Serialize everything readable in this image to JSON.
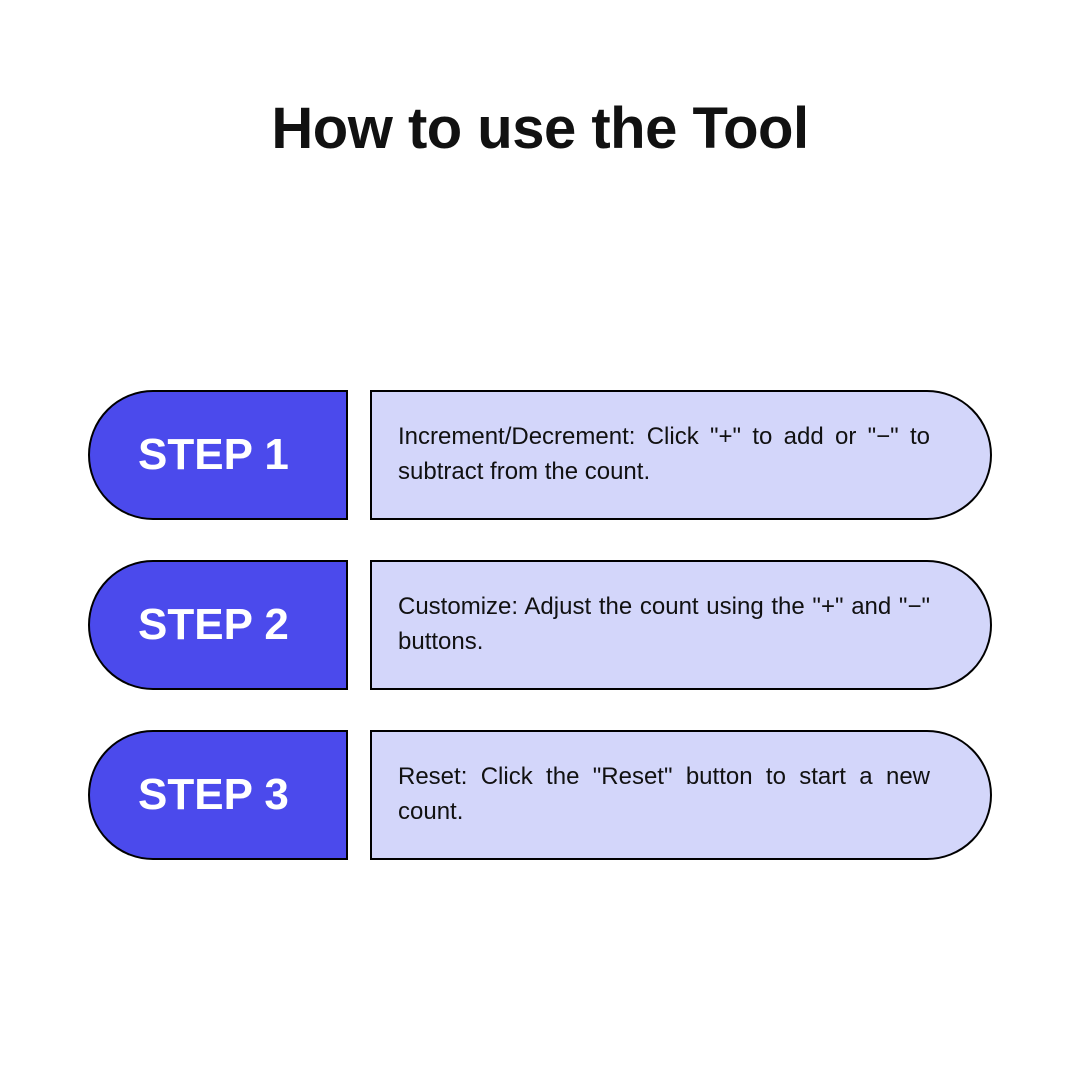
{
  "title": "How to use the Tool",
  "steps": [
    {
      "label": "STEP 1",
      "description": "Increment/Decrement: Click \"+\" to add or \"−\" to subtract from the count."
    },
    {
      "label": "STEP 2",
      "description": "Customize: Adjust the count using the \"+\" and \"−\" buttons."
    },
    {
      "label": "STEP 3",
      "description": "Reset: Click the \"Reset\" button to start a new count."
    }
  ],
  "colors": {
    "badge_bg": "#4b4aec",
    "content_bg": "#d3d6fa",
    "border": "#000000",
    "text": "#111111",
    "badge_text": "#ffffff"
  }
}
